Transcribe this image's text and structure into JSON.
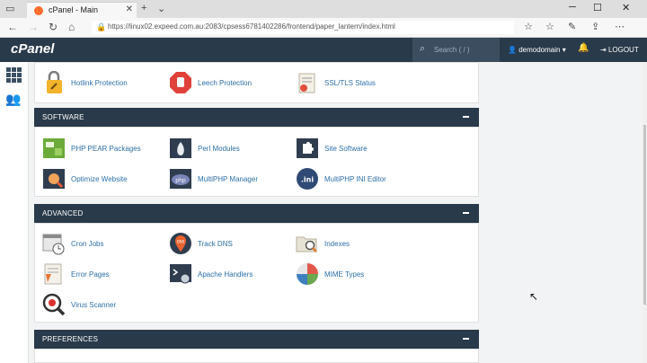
{
  "browser": {
    "tab_title": "cPanel - Main",
    "url": "https://linux02.expeed.com.au:2083/cpsess6781402286/frontend/paper_lantern/index.html"
  },
  "header": {
    "logo": "cPanel",
    "search_placeholder": "Search ( / )",
    "user": "demodomain",
    "logout": "LOGOUT"
  },
  "security_partial": {
    "items": [
      {
        "label": "Hotlink Protection",
        "icon": "lock-chain-icon"
      },
      {
        "label": "Leech Protection",
        "icon": "stop-hand-icon"
      },
      {
        "label": "SSL/TLS Status",
        "icon": "certificate-icon"
      }
    ]
  },
  "software": {
    "title": "SOFTWARE",
    "items": [
      {
        "label": "PHP PEAR Packages",
        "icon": "php-pear-icon"
      },
      {
        "label": "Perl Modules",
        "icon": "perl-onion-icon"
      },
      {
        "label": "Site Software",
        "icon": "puzzle-icon"
      },
      {
        "label": "Optimize Website",
        "icon": "optimize-icon"
      },
      {
        "label": "MultiPHP Manager",
        "icon": "php-manager-icon"
      },
      {
        "label": "MultiPHP INI Editor",
        "icon": "ini-editor-icon"
      }
    ]
  },
  "advanced": {
    "title": "ADVANCED",
    "items": [
      {
        "label": "Cron Jobs",
        "icon": "calendar-clock-icon"
      },
      {
        "label": "Track DNS",
        "icon": "dns-pin-icon"
      },
      {
        "label": "Indexes",
        "icon": "folder-search-icon"
      },
      {
        "label": "Error Pages",
        "icon": "error-page-icon"
      },
      {
        "label": "Apache Handlers",
        "icon": "terminal-gear-icon"
      },
      {
        "label": "MIME Types",
        "icon": "mime-types-icon"
      },
      {
        "label": "Virus Scanner",
        "icon": "virus-scanner-icon"
      }
    ]
  },
  "preferences": {
    "title": "PREFERENCES"
  }
}
